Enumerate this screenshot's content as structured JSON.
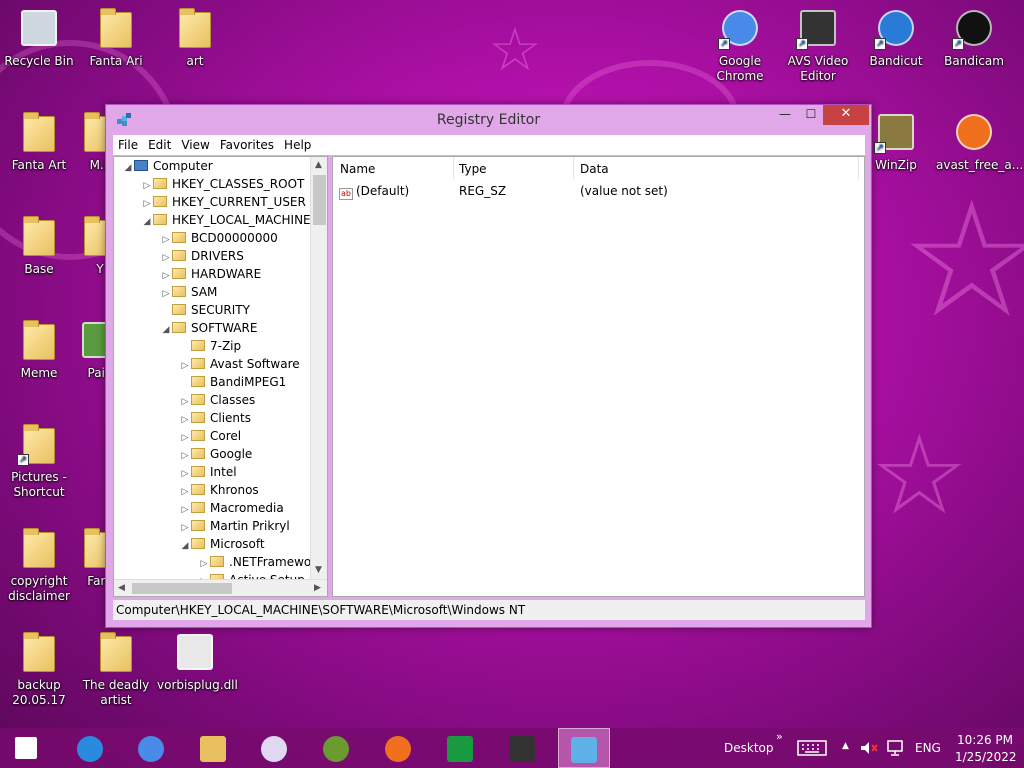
{
  "desktop_icons": [
    {
      "label": "Recycle Bin",
      "icon": "recycle-bin-icon"
    },
    {
      "label": "Fanta Ari",
      "icon": "folder-icon"
    },
    {
      "label": "art",
      "icon": "folder-icon"
    },
    {
      "label": "Google Chrome",
      "icon": "chrome-icon"
    },
    {
      "label": "AVS Video Editor",
      "icon": "film-icon"
    },
    {
      "label": "Bandicut",
      "icon": "bandicut-icon"
    },
    {
      "label": "Bandicam",
      "icon": "bandicam-icon"
    },
    {
      "label": "Fanta Art",
      "icon": "folder-icon"
    },
    {
      "label": "M.L",
      "icon": "folder-icon"
    },
    {
      "label": "WinZip",
      "icon": "winzip-icon"
    },
    {
      "label": "avast_free_a...",
      "icon": "avast-icon"
    },
    {
      "label": "Base",
      "icon": "folder-icon"
    },
    {
      "label": "Y",
      "icon": "folder-icon"
    },
    {
      "label": "Meme",
      "icon": "folder-icon"
    },
    {
      "label": "Pain",
      "icon": "paint-icon"
    },
    {
      "label": "Pictures - Shortcut",
      "icon": "folder-icon"
    },
    {
      "label": "copyright disclaimer",
      "icon": "folder-icon"
    },
    {
      "label": "Fant",
      "icon": "folder-icon"
    },
    {
      "label": "backup 20.05.17",
      "icon": "folder-icon"
    },
    {
      "label": "The deadly artist",
      "icon": "folder-icon"
    },
    {
      "label": "vorbisplug.dll",
      "icon": "dll-icon"
    }
  ],
  "window": {
    "title": "Registry Editor",
    "minimize": "—",
    "maximize": "☐",
    "close": "✕",
    "menu": [
      "File",
      "Edit",
      "View",
      "Favorites",
      "Help"
    ],
    "tree": [
      {
        "label": "Computer",
        "depth": 0,
        "arrow": "◢",
        "icon": "computer-icon"
      },
      {
        "label": "HKEY_CLASSES_ROOT",
        "depth": 1,
        "arrow": "▷"
      },
      {
        "label": "HKEY_CURRENT_USER",
        "depth": 1,
        "arrow": "▷"
      },
      {
        "label": "HKEY_LOCAL_MACHINE",
        "depth": 1,
        "arrow": "◢"
      },
      {
        "label": "BCD00000000",
        "depth": 2,
        "arrow": "▷"
      },
      {
        "label": "DRIVERS",
        "depth": 2,
        "arrow": "▷"
      },
      {
        "label": "HARDWARE",
        "depth": 2,
        "arrow": "▷"
      },
      {
        "label": "SAM",
        "depth": 2,
        "arrow": "▷"
      },
      {
        "label": "SECURITY",
        "depth": 2,
        "arrow": ""
      },
      {
        "label": "SOFTWARE",
        "depth": 2,
        "arrow": "◢"
      },
      {
        "label": "7-Zip",
        "depth": 3,
        "arrow": ""
      },
      {
        "label": "Avast Software",
        "depth": 3,
        "arrow": "▷"
      },
      {
        "label": "BandiMPEG1",
        "depth": 3,
        "arrow": ""
      },
      {
        "label": "Classes",
        "depth": 3,
        "arrow": "▷"
      },
      {
        "label": "Clients",
        "depth": 3,
        "arrow": "▷"
      },
      {
        "label": "Corel",
        "depth": 3,
        "arrow": "▷"
      },
      {
        "label": "Google",
        "depth": 3,
        "arrow": "▷"
      },
      {
        "label": "Intel",
        "depth": 3,
        "arrow": "▷"
      },
      {
        "label": "Khronos",
        "depth": 3,
        "arrow": "▷"
      },
      {
        "label": "Macromedia",
        "depth": 3,
        "arrow": "▷"
      },
      {
        "label": "Martin Prikryl",
        "depth": 3,
        "arrow": "▷"
      },
      {
        "label": "Microsoft",
        "depth": 3,
        "arrow": "◢"
      },
      {
        "label": ".NETFramewor",
        "depth": 4,
        "arrow": "▷"
      },
      {
        "label": "Active Setup",
        "depth": 4,
        "arrow": "▷"
      }
    ],
    "columns": [
      "Name",
      "Type",
      "Data"
    ],
    "values": [
      {
        "name": "(Default)",
        "type": "REG_SZ",
        "data": "(value not set)",
        "icon": "ab"
      }
    ],
    "status": "Computer\\HKEY_LOCAL_MACHINE\\SOFTWARE\\Microsoft\\Windows NT"
  },
  "taskbar": {
    "apps": [
      "start-icon",
      "ie-icon",
      "chrome-icon",
      "explorer-icon",
      "paint-icon",
      "globe-icon",
      "firefox-icon",
      "store-icon",
      "film-icon",
      "regedit-icon"
    ],
    "desktop_label": "Desktop",
    "chevron": "»",
    "lang": "ENG",
    "time": "10:26 PM",
    "date": "1/25/2022"
  }
}
